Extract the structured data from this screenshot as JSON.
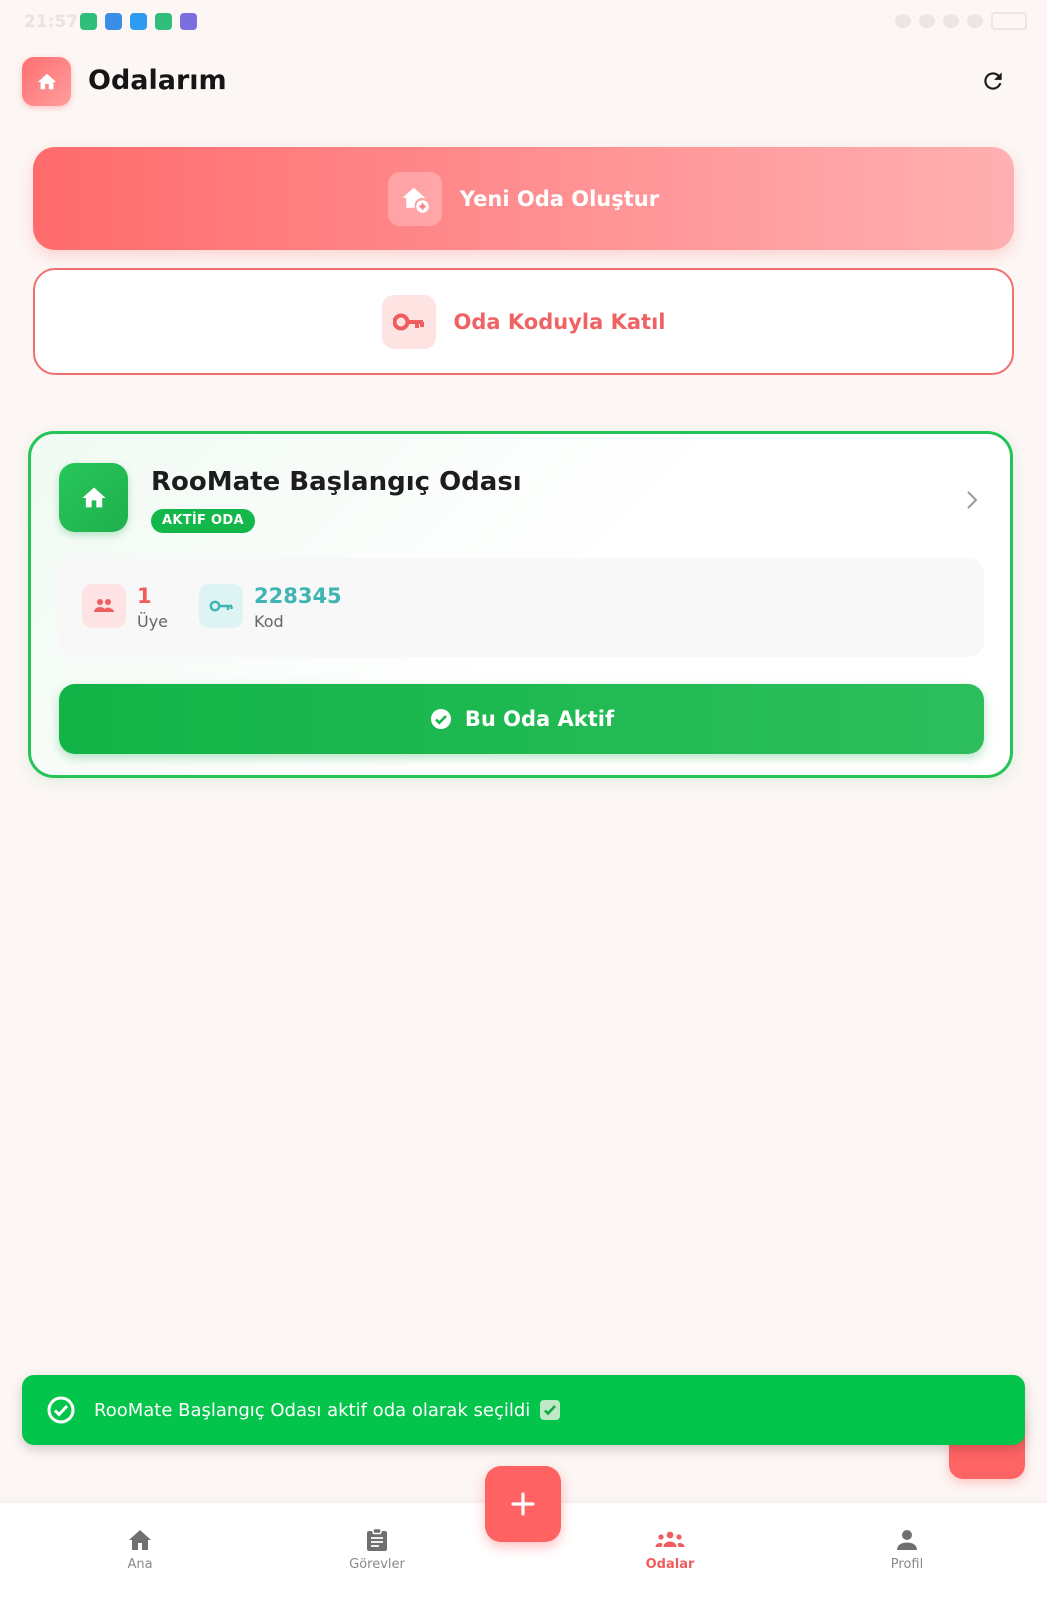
{
  "status_bar": {
    "time": "21:57"
  },
  "header": {
    "title": "Odalarım"
  },
  "actions": {
    "create_label": "Yeni Oda Oluştur",
    "join_label": "Oda Koduyla Katıl"
  },
  "room": {
    "name": "RooMate Başlangıç Odası",
    "badge": "AKTİF ODA",
    "members_value": "1",
    "members_label": "Üye",
    "code_value": "228345",
    "code_label": "Kod",
    "active_button_label": "Bu Oda Aktif"
  },
  "toast": {
    "message": "RooMate Başlangıç Odası aktif oda olarak seçildi"
  },
  "nav": {
    "home": "Ana",
    "tasks": "Görevler",
    "rooms": "Odalar",
    "profile": "Profil",
    "active": "rooms"
  },
  "colors": {
    "accent_red": "#ff6b6c",
    "accent_green": "#14b84a",
    "teal": "#3fb5b3",
    "background": "#fcf6f4"
  },
  "icons": {
    "logo": "home-icon",
    "refresh": "refresh-icon",
    "create": "home-add-icon",
    "join": "key-icon",
    "room": "home-icon",
    "members": "people-icon",
    "code": "key-icon",
    "active": "check-circle-icon",
    "fab": "plus-icon"
  }
}
